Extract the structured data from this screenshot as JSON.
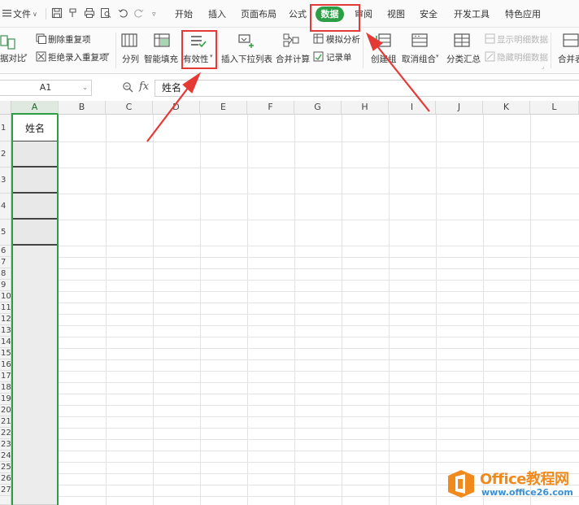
{
  "menubar": {
    "file_label": "文件",
    "tabs": [
      "开始",
      "插入",
      "页面布局",
      "公式",
      "数据",
      "审阅",
      "视图",
      "安全",
      "开发工具",
      "特色应用"
    ],
    "active_tab": "数据"
  },
  "ribbon": {
    "partial_left_label": "据对比",
    "remove_dup": "删除重复项",
    "reject_dup": "拒绝录入重复项",
    "split": "分列",
    "smart_fill": "智能填充",
    "validity": "有效性",
    "insert_dropdown": "插入下拉列表",
    "merge_calc": "合并计算",
    "what_if": "模拟分析",
    "record_form": "记录单",
    "create_group": "创建组",
    "ungroup": "取消组合",
    "subtotal": "分类汇总",
    "show_detail": "显示明细数据",
    "hide_detail": "隐藏明细数据",
    "partial_right_label": "合并表"
  },
  "formula_bar": {
    "name_box": "A1",
    "fx": "fx",
    "content": "姓名"
  },
  "sheet": {
    "columns": [
      "A",
      "B",
      "C",
      "D",
      "E",
      "F",
      "G",
      "H",
      "I",
      "J",
      "K",
      "L"
    ],
    "selected_column": "A",
    "row_numbers": [
      "1",
      "2",
      "3",
      "4",
      "5",
      "6",
      "7",
      "8",
      "9",
      "10",
      "11",
      "12",
      "13",
      "14",
      "15",
      "16",
      "17",
      "18",
      "19",
      "20",
      "21",
      "22",
      "23",
      "24",
      "25",
      "26",
      "27"
    ],
    "a1_value": "姓名"
  },
  "watermark": {
    "title": "Office教程网",
    "url": "www.office26.com"
  },
  "colors": {
    "accent_green": "#2e9e46",
    "annotation_red": "#e53935",
    "watermark_orange": "#f08a1c",
    "watermark_blue": "#3b8fd1"
  }
}
